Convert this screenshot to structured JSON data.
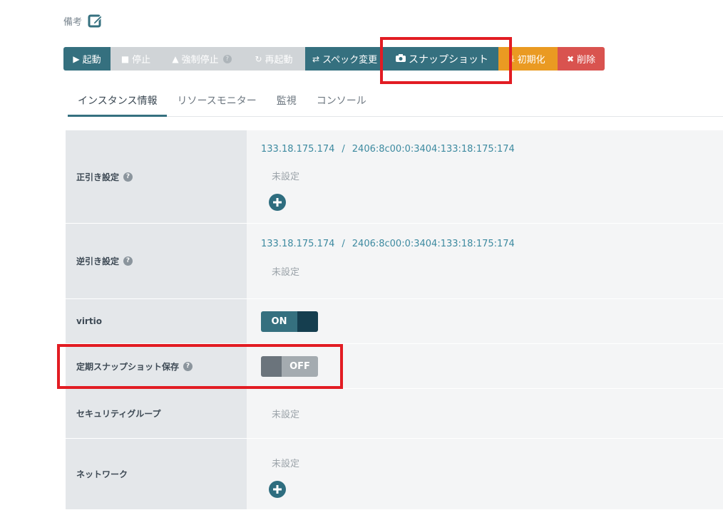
{
  "memo": {
    "label": "備考"
  },
  "toolbar": {
    "start": "起動",
    "stop": "停止",
    "force_stop": "強制停止",
    "restart": "再起動",
    "spec_change": "スペック変更",
    "snapshot": "スナップショット",
    "initialize": "初期化",
    "delete": "削除"
  },
  "tabs": [
    {
      "label": "インスタンス情報",
      "active": true
    },
    {
      "label": "リソースモニター",
      "active": false
    },
    {
      "label": "監視",
      "active": false
    },
    {
      "label": "コンソール",
      "active": false
    }
  ],
  "rows": {
    "forward_dns": {
      "label": "正引き設定",
      "ipv4": "133.18.175.174",
      "separator": "/",
      "ipv6": "2406:8c00:0:3404:133:18:175:174",
      "value": "未設定"
    },
    "reverse_dns": {
      "label": "逆引き設定",
      "ipv4": "133.18.175.174",
      "separator": "/",
      "ipv6": "2406:8c00:0:3404:133:18:175:174",
      "value": "未設定"
    },
    "virtio": {
      "label": "virtio",
      "state": "ON"
    },
    "scheduled_snapshot": {
      "label": "定期スナップショット保存",
      "state": "OFF"
    },
    "security_group": {
      "label": "セキュリティグループ",
      "value": "未設定"
    },
    "network": {
      "label": "ネットワーク",
      "value": "未設定"
    }
  },
  "colors": {
    "primary": "#35707f",
    "warning": "#ea9a22",
    "danger": "#d9534f",
    "highlight": "#e21c23"
  }
}
